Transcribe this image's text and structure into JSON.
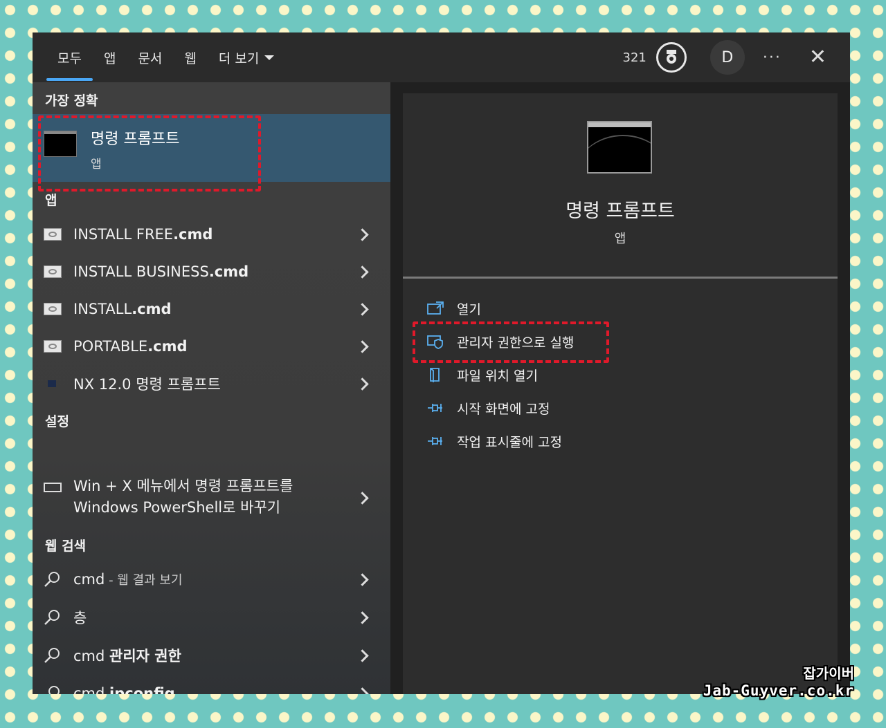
{
  "topbar": {
    "tabs": [
      {
        "label": "모두"
      },
      {
        "label": "앱"
      },
      {
        "label": "문서"
      },
      {
        "label": "웹"
      },
      {
        "label": "더 보기"
      }
    ],
    "points": "321",
    "avatar_letter": "D",
    "more_label": "···",
    "close_label": "✕"
  },
  "left": {
    "best_match_heading": "가장 정확",
    "best_match": {
      "name": "명령 프롬프트",
      "type": "앱"
    },
    "apps_heading": "앱",
    "apps": [
      {
        "name_plain": "INSTALL FREE",
        "name_bold": ".cmd"
      },
      {
        "name_plain": "INSTALL BUSINESS",
        "name_bold": ".cmd"
      },
      {
        "name_plain": "INSTALL",
        "name_bold": ".cmd"
      },
      {
        "name_plain": "PORTABLE",
        "name_bold": ".cmd"
      },
      {
        "name_plain": "NX 12.0 명령 프롬프트",
        "name_bold": ""
      }
    ],
    "settings_heading": "설정",
    "settings": [
      {
        "line1": "Win + X 메뉴에서 명령 프롬프트를",
        "line2": "Windows PowerShell로 바꾸기"
      }
    ],
    "web_heading": "웹 검색",
    "web": [
      {
        "plain": "cmd",
        "suffix": " - 웹 결과 보기",
        "bold": ""
      },
      {
        "plain": "층",
        "suffix": "",
        "bold": ""
      },
      {
        "plain": "cmd ",
        "suffix": "",
        "bold": "관리자 권한"
      },
      {
        "plain": "cmd ",
        "suffix": "",
        "bold": "ipconfig"
      }
    ]
  },
  "right": {
    "title": "명령 프롬프트",
    "subtitle": "앱",
    "actions": [
      {
        "label": "열기",
        "icon": "open-icon"
      },
      {
        "label": "관리자 권한으로 실행",
        "icon": "admin-shield-icon"
      },
      {
        "label": "파일 위치 열기",
        "icon": "folder-icon"
      },
      {
        "label": "시작 화면에 고정",
        "icon": "pin-icon"
      },
      {
        "label": "작업 표시줄에 고정",
        "icon": "pin-icon"
      }
    ]
  },
  "watermark": {
    "line1": "잡가이버",
    "line2": "Jab-Guyver.co.kr"
  },
  "colors": {
    "accent": "#4aa7f5",
    "highlight": "#355870",
    "annotation": "#e0192a"
  }
}
